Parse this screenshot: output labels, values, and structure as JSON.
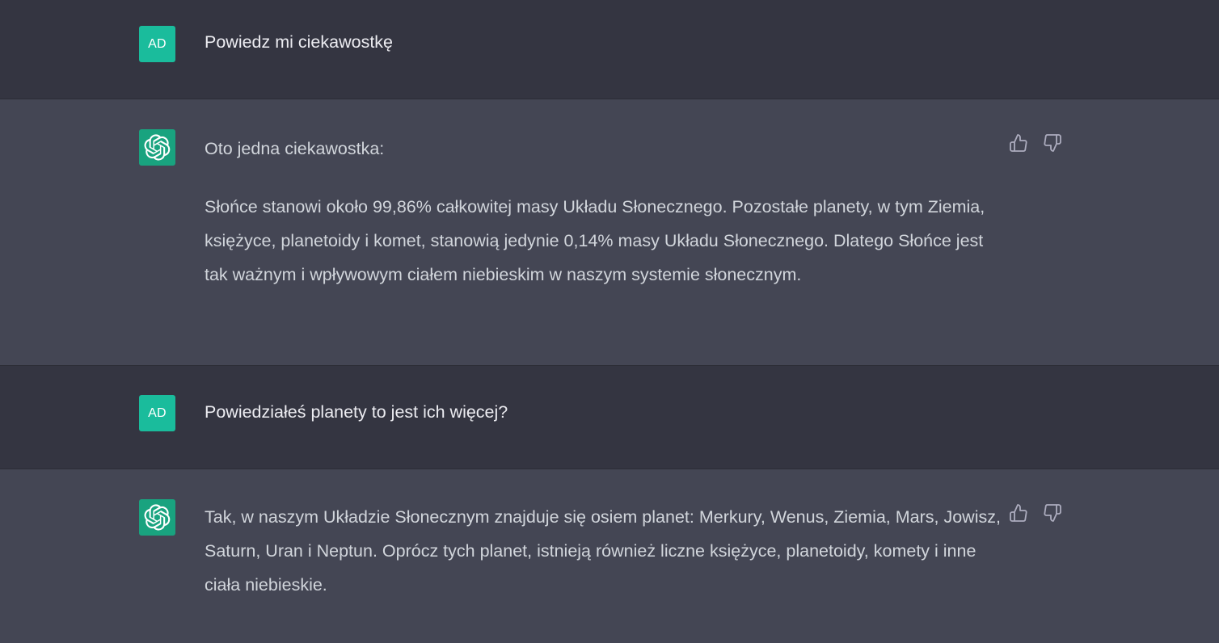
{
  "messages": [
    {
      "role": "user",
      "avatar_initials": "AD",
      "paragraphs": [
        "Powiedz mi ciekawostkę"
      ]
    },
    {
      "role": "assistant",
      "avatar_icon": "openai-logo-icon",
      "paragraphs": [
        "Oto jedna ciekawostka:",
        "Słońce stanowi około 99,86% całkowitej masy Układu Słonecznego. Pozostałe planety, w tym Ziemia, księżyce, planetoidy i komet, stanowią jedynie 0,14% masy Układu Słonecznego. Dlatego Słońce jest tak ważnym i wpływowym ciałem niebieskim w naszym systemie słonecznym."
      ],
      "feedback_icons": [
        "thumbs-up-icon",
        "thumbs-down-icon"
      ]
    },
    {
      "role": "user",
      "avatar_initials": "AD",
      "paragraphs": [
        "Powiedziałeś planety to jest ich więcej?"
      ]
    },
    {
      "role": "assistant",
      "avatar_icon": "openai-logo-icon",
      "paragraphs": [
        "Tak, w naszym Układzie Słonecznym znajduje się osiem planet: Merkury, Wenus, Ziemia, Mars, Jowisz, Saturn, Uran i Neptun. Oprócz tych planet, istnieją również liczne księżyce, planetoidy, komety i inne ciała niebieskie."
      ],
      "feedback_icons": [
        "thumbs-up-icon",
        "thumbs-down-icon"
      ]
    }
  ],
  "colors": {
    "user_bg": "#343541",
    "assistant_bg": "#444654",
    "avatar_user": "#1abc9c",
    "avatar_assistant": "#19a37f",
    "text": "#ececf1"
  }
}
